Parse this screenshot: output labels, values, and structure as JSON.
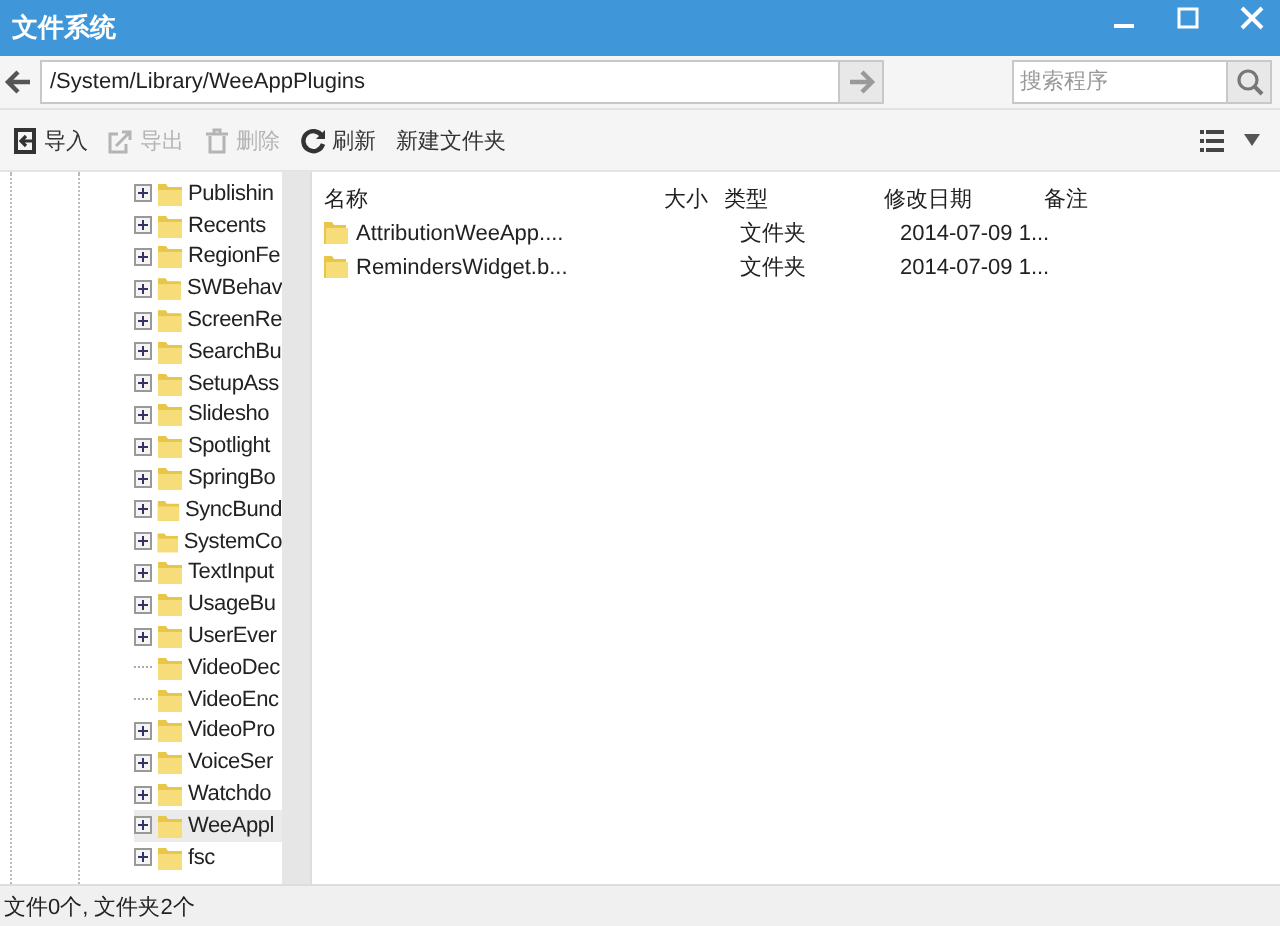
{
  "window": {
    "title": "文件系统"
  },
  "address": {
    "path": "/System/Library/WeeAppPlugins"
  },
  "search": {
    "placeholder": "搜索程序"
  },
  "toolbar": [
    {
      "label": "导入",
      "kind": "import",
      "disabled": false
    },
    {
      "label": "导出",
      "kind": "export",
      "disabled": true
    },
    {
      "label": "删除",
      "kind": "delete",
      "disabled": true
    },
    {
      "label": "刷新",
      "kind": "refresh",
      "disabled": false
    },
    {
      "label": "新建文件夹",
      "kind": "plain",
      "disabled": false
    }
  ],
  "tree": {
    "items": [
      {
        "name": "Publishin",
        "expandable": true,
        "selected": false
      },
      {
        "name": "Recents",
        "expandable": true,
        "selected": false
      },
      {
        "name": "RegionFe",
        "expandable": true,
        "selected": false
      },
      {
        "name": "SWBehav",
        "expandable": true,
        "selected": false
      },
      {
        "name": "ScreenRe",
        "expandable": true,
        "selected": false
      },
      {
        "name": "SearchBu",
        "expandable": true,
        "selected": false
      },
      {
        "name": "SetupAss",
        "expandable": true,
        "selected": false
      },
      {
        "name": "Slidesho",
        "expandable": true,
        "selected": false
      },
      {
        "name": "Spotlight",
        "expandable": true,
        "selected": false
      },
      {
        "name": "SpringBo",
        "expandable": true,
        "selected": false
      },
      {
        "name": "SyncBund",
        "expandable": true,
        "selected": false
      },
      {
        "name": "SystemCo",
        "expandable": true,
        "selected": false
      },
      {
        "name": "TextInput",
        "expandable": true,
        "selected": false
      },
      {
        "name": "UsageBu",
        "expandable": true,
        "selected": false
      },
      {
        "name": "UserEver",
        "expandable": true,
        "selected": false
      },
      {
        "name": "VideoDec",
        "expandable": false,
        "selected": false
      },
      {
        "name": "VideoEnc",
        "expandable": false,
        "selected": false
      },
      {
        "name": "VideoPro",
        "expandable": true,
        "selected": false
      },
      {
        "name": "VoiceSer",
        "expandable": true,
        "selected": false
      },
      {
        "name": "Watchdo",
        "expandable": true,
        "selected": false
      },
      {
        "name": "WeeAppl",
        "expandable": true,
        "selected": true
      },
      {
        "name": "fsc",
        "expandable": true,
        "selected": false
      }
    ]
  },
  "table": {
    "columns": [
      "名称",
      "大小",
      "类型",
      "修改日期",
      "备注"
    ],
    "rows": [
      {
        "name": "AttributionWeeApp....",
        "type": "文件夹",
        "modified": "2014-07-09 1..."
      },
      {
        "name": "RemindersWidget.b...",
        "type": "文件夹",
        "modified": "2014-07-09 1..."
      }
    ]
  },
  "status_bar": "文件0个, 文件夹2个"
}
